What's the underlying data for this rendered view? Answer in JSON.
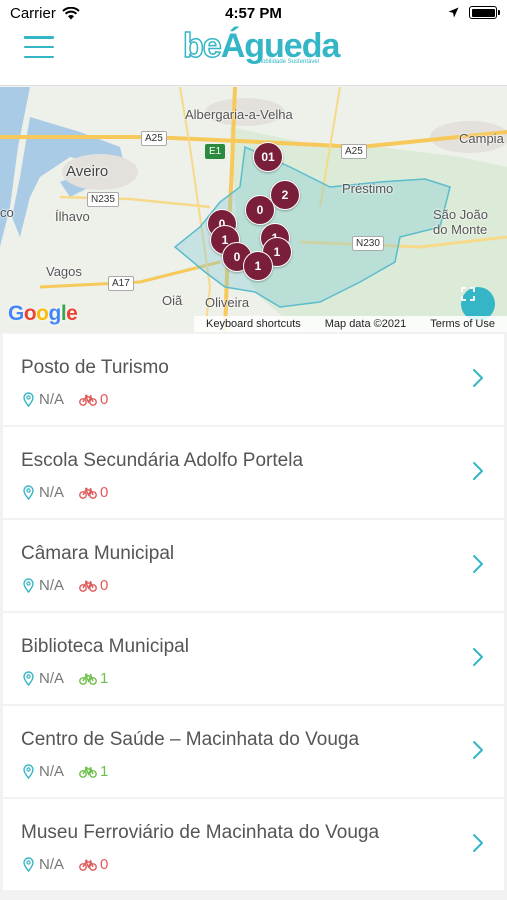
{
  "status": {
    "carrier": "Carrier",
    "time": "4:57 PM"
  },
  "header": {
    "logo_be": "be",
    "logo_name": "Águeda",
    "logo_tagline": "Mobilidade Sustentável"
  },
  "colors": {
    "accent": "#35b6c7",
    "cluster": "#7a1f3a",
    "bikes_zero": "#e05a5a",
    "bikes_available": "#6cc04a"
  },
  "map": {
    "labels": {
      "albergaria": "Albergaria-a-Velha",
      "aveiro": "Aveiro",
      "ilhavo": "Ílhavo",
      "vagos": "Vagos",
      "oia": "Oiã",
      "oliveira": "Oliveira",
      "prestimo": "Préstimo",
      "sao_joao": "São João",
      "do_monte": "do Monte",
      "campia": "Campia",
      "co": "co"
    },
    "roads": {
      "a25_left": "A25",
      "a25_right": "A25",
      "e1": "E1",
      "n235": "N235",
      "a17": "A17",
      "n230": "N230"
    },
    "clusters": [
      "01",
      "2",
      "0",
      "0",
      "1",
      "1",
      "0",
      "1",
      "1"
    ],
    "google": "Google",
    "footer": {
      "shortcuts": "Keyboard shortcuts",
      "data": "Map data ©2021",
      "terms": "Terms of Use"
    }
  },
  "stations": [
    {
      "name": "Posto de Turismo",
      "distance": "N/A",
      "bikes": "0",
      "available": false
    },
    {
      "name": "Escola Secundária Adolfo Portela",
      "distance": "N/A",
      "bikes": "0",
      "available": false
    },
    {
      "name": "Câmara Municipal",
      "distance": "N/A",
      "bikes": "0",
      "available": false
    },
    {
      "name": "Biblioteca Municipal",
      "distance": "N/A",
      "bikes": "1",
      "available": true
    },
    {
      "name": "Centro de Saúde – Macinhata do Vouga",
      "distance": "N/A",
      "bikes": "1",
      "available": true
    },
    {
      "name": "Museu Ferroviário de Macinhata do Vouga",
      "distance": "N/A",
      "bikes": "0",
      "available": false
    }
  ]
}
